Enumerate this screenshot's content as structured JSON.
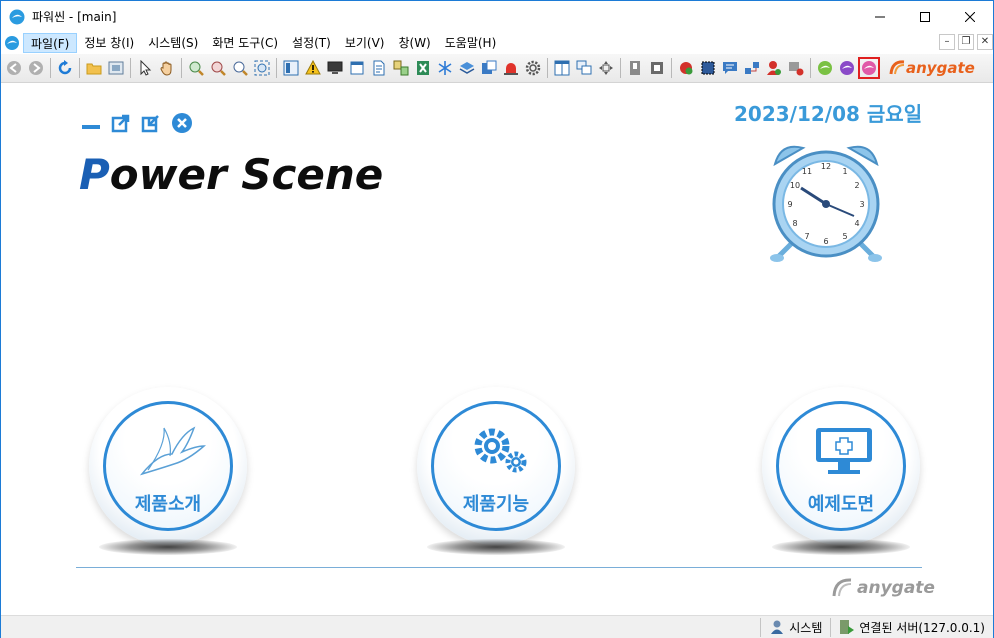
{
  "window": {
    "title": "파워씬 - [main]"
  },
  "menu": {
    "items": [
      "파일(F)",
      "정보 창(I)",
      "시스템(S)",
      "화면 도구(C)",
      "설정(T)",
      "보기(V)",
      "창(W)",
      "도움말(H)"
    ]
  },
  "toolbar": {
    "brand": "anygate"
  },
  "main": {
    "date": "2023/12/08 금요일",
    "brand_p": "P",
    "brand_rest": "ower Scene",
    "buttons": [
      "제품소개",
      "제품기능",
      "예제도면"
    ],
    "footer_brand": "anygate"
  },
  "status": {
    "user": "시스템",
    "connection": "연결된 서버(127.0.0.1)"
  },
  "colors": {
    "accent": "#2e8ad6",
    "title_blue": "#1a5fb4",
    "brand_orange": "#e8611c"
  }
}
